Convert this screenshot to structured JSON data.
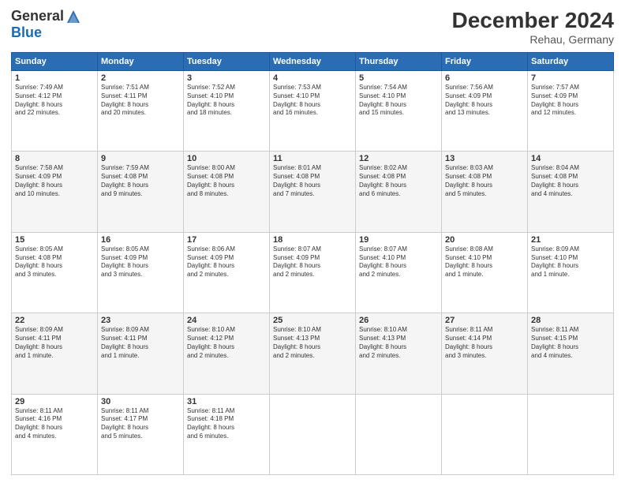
{
  "header": {
    "logo_general": "General",
    "logo_blue": "Blue",
    "title": "December 2024",
    "location": "Rehau, Germany"
  },
  "days_of_week": [
    "Sunday",
    "Monday",
    "Tuesday",
    "Wednesday",
    "Thursday",
    "Friday",
    "Saturday"
  ],
  "weeks": [
    [
      {
        "day": "1",
        "info": "Sunrise: 7:49 AM\nSunset: 4:12 PM\nDaylight: 8 hours\nand 22 minutes."
      },
      {
        "day": "2",
        "info": "Sunrise: 7:51 AM\nSunset: 4:11 PM\nDaylight: 8 hours\nand 20 minutes."
      },
      {
        "day": "3",
        "info": "Sunrise: 7:52 AM\nSunset: 4:10 PM\nDaylight: 8 hours\nand 18 minutes."
      },
      {
        "day": "4",
        "info": "Sunrise: 7:53 AM\nSunset: 4:10 PM\nDaylight: 8 hours\nand 16 minutes."
      },
      {
        "day": "5",
        "info": "Sunrise: 7:54 AM\nSunset: 4:10 PM\nDaylight: 8 hours\nand 15 minutes."
      },
      {
        "day": "6",
        "info": "Sunrise: 7:56 AM\nSunset: 4:09 PM\nDaylight: 8 hours\nand 13 minutes."
      },
      {
        "day": "7",
        "info": "Sunrise: 7:57 AM\nSunset: 4:09 PM\nDaylight: 8 hours\nand 12 minutes."
      }
    ],
    [
      {
        "day": "8",
        "info": "Sunrise: 7:58 AM\nSunset: 4:09 PM\nDaylight: 8 hours\nand 10 minutes."
      },
      {
        "day": "9",
        "info": "Sunrise: 7:59 AM\nSunset: 4:08 PM\nDaylight: 8 hours\nand 9 minutes."
      },
      {
        "day": "10",
        "info": "Sunrise: 8:00 AM\nSunset: 4:08 PM\nDaylight: 8 hours\nand 8 minutes."
      },
      {
        "day": "11",
        "info": "Sunrise: 8:01 AM\nSunset: 4:08 PM\nDaylight: 8 hours\nand 7 minutes."
      },
      {
        "day": "12",
        "info": "Sunrise: 8:02 AM\nSunset: 4:08 PM\nDaylight: 8 hours\nand 6 minutes."
      },
      {
        "day": "13",
        "info": "Sunrise: 8:03 AM\nSunset: 4:08 PM\nDaylight: 8 hours\nand 5 minutes."
      },
      {
        "day": "14",
        "info": "Sunrise: 8:04 AM\nSunset: 4:08 PM\nDaylight: 8 hours\nand 4 minutes."
      }
    ],
    [
      {
        "day": "15",
        "info": "Sunrise: 8:05 AM\nSunset: 4:08 PM\nDaylight: 8 hours\nand 3 minutes."
      },
      {
        "day": "16",
        "info": "Sunrise: 8:05 AM\nSunset: 4:09 PM\nDaylight: 8 hours\nand 3 minutes."
      },
      {
        "day": "17",
        "info": "Sunrise: 8:06 AM\nSunset: 4:09 PM\nDaylight: 8 hours\nand 2 minutes."
      },
      {
        "day": "18",
        "info": "Sunrise: 8:07 AM\nSunset: 4:09 PM\nDaylight: 8 hours\nand 2 minutes."
      },
      {
        "day": "19",
        "info": "Sunrise: 8:07 AM\nSunset: 4:10 PM\nDaylight: 8 hours\nand 2 minutes."
      },
      {
        "day": "20",
        "info": "Sunrise: 8:08 AM\nSunset: 4:10 PM\nDaylight: 8 hours\nand 1 minute."
      },
      {
        "day": "21",
        "info": "Sunrise: 8:09 AM\nSunset: 4:10 PM\nDaylight: 8 hours\nand 1 minute."
      }
    ],
    [
      {
        "day": "22",
        "info": "Sunrise: 8:09 AM\nSunset: 4:11 PM\nDaylight: 8 hours\nand 1 minute."
      },
      {
        "day": "23",
        "info": "Sunrise: 8:09 AM\nSunset: 4:11 PM\nDaylight: 8 hours\nand 1 minute."
      },
      {
        "day": "24",
        "info": "Sunrise: 8:10 AM\nSunset: 4:12 PM\nDaylight: 8 hours\nand 2 minutes."
      },
      {
        "day": "25",
        "info": "Sunrise: 8:10 AM\nSunset: 4:13 PM\nDaylight: 8 hours\nand 2 minutes."
      },
      {
        "day": "26",
        "info": "Sunrise: 8:10 AM\nSunset: 4:13 PM\nDaylight: 8 hours\nand 2 minutes."
      },
      {
        "day": "27",
        "info": "Sunrise: 8:11 AM\nSunset: 4:14 PM\nDaylight: 8 hours\nand 3 minutes."
      },
      {
        "day": "28",
        "info": "Sunrise: 8:11 AM\nSunset: 4:15 PM\nDaylight: 8 hours\nand 4 minutes."
      }
    ],
    [
      {
        "day": "29",
        "info": "Sunrise: 8:11 AM\nSunset: 4:16 PM\nDaylight: 8 hours\nand 4 minutes."
      },
      {
        "day": "30",
        "info": "Sunrise: 8:11 AM\nSunset: 4:17 PM\nDaylight: 8 hours\nand 5 minutes."
      },
      {
        "day": "31",
        "info": "Sunrise: 8:11 AM\nSunset: 4:18 PM\nDaylight: 8 hours\nand 6 minutes."
      },
      {
        "day": "",
        "info": ""
      },
      {
        "day": "",
        "info": ""
      },
      {
        "day": "",
        "info": ""
      },
      {
        "day": "",
        "info": ""
      }
    ]
  ]
}
